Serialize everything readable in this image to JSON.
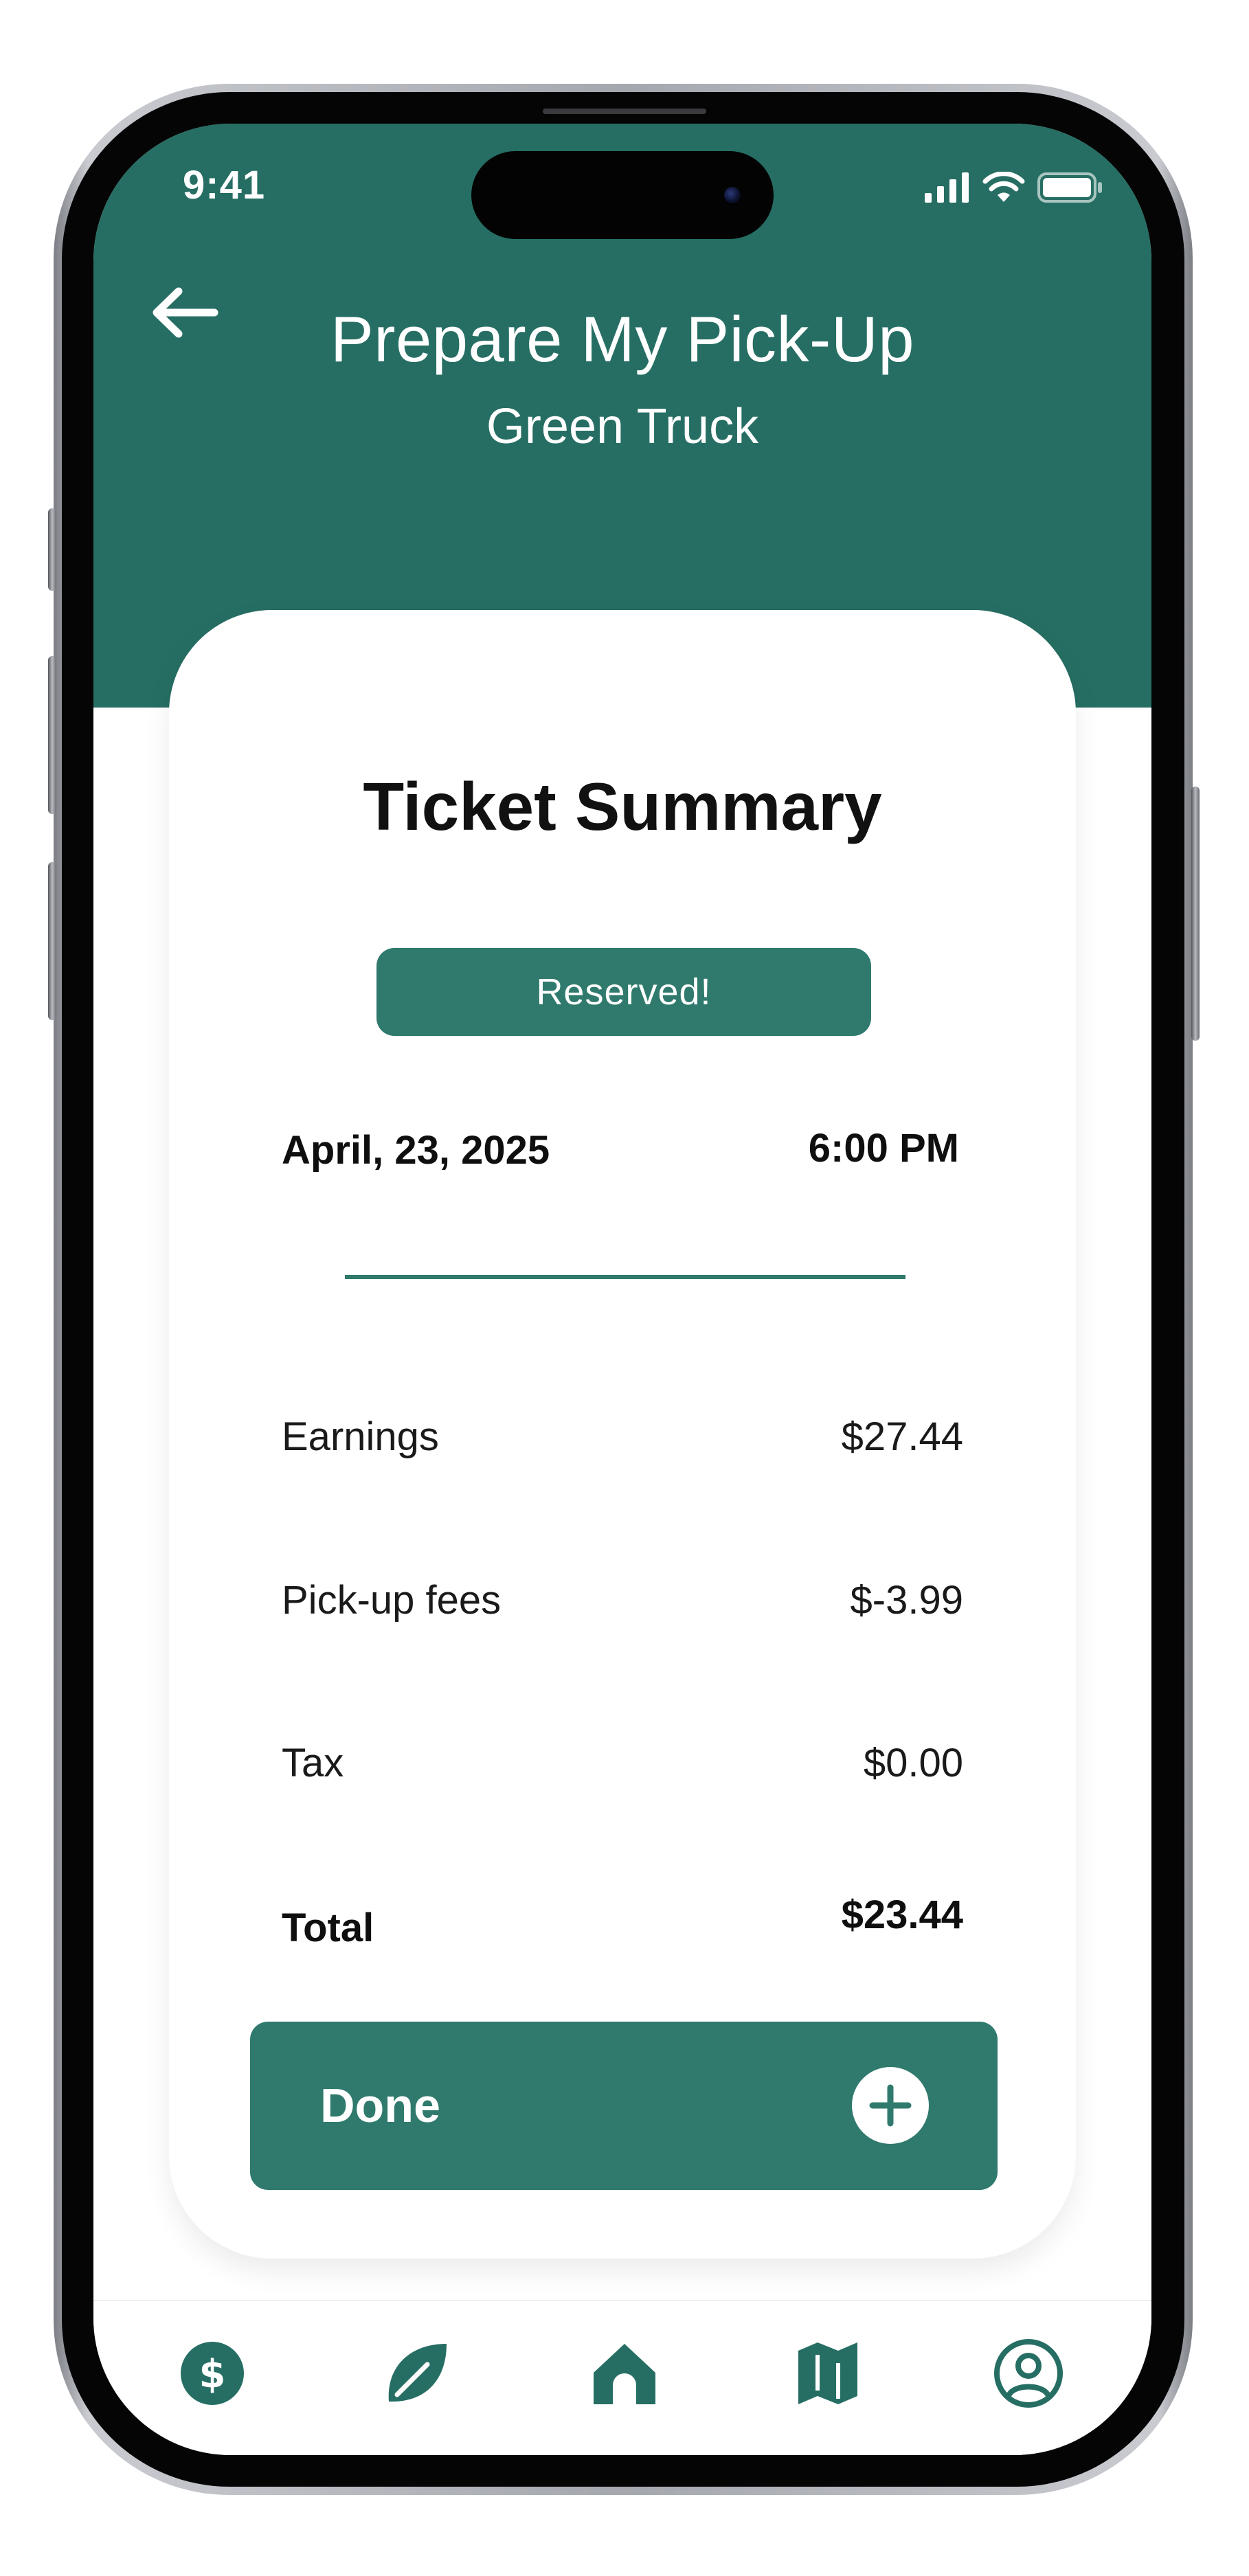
{
  "status_bar": {
    "time": "9:41",
    "icons": [
      "cellular-signal-icon",
      "wifi-icon",
      "battery-icon"
    ]
  },
  "header": {
    "back_icon": "back-arrow-icon",
    "title": "Prepare My Pick-Up",
    "subtitle": "Green Truck"
  },
  "ticket": {
    "title": "Ticket Summary",
    "status": "Reserved!",
    "date": "April, 23, 2025",
    "time": "6:00 PM",
    "rows": [
      {
        "label": "Earnings",
        "value": "$27.44"
      },
      {
        "label": "Pick-up fees",
        "value": "$-3.99"
      },
      {
        "label": "Tax",
        "value": "$0.00"
      }
    ],
    "total": {
      "label": "Total",
      "value": "$23.44"
    },
    "done_button": {
      "label": "Done",
      "icon": "plus-circle-icon"
    }
  },
  "bottom_nav": {
    "items": [
      {
        "icon": "dollar-coin-icon"
      },
      {
        "icon": "leaf-icon"
      },
      {
        "icon": "home-icon"
      },
      {
        "icon": "map-icon"
      },
      {
        "icon": "profile-icon"
      }
    ]
  },
  "colors": {
    "brand_green": "#266e63",
    "button_green": "#2f7a6d",
    "text_dark": "#111111",
    "background": "#ffffff"
  }
}
